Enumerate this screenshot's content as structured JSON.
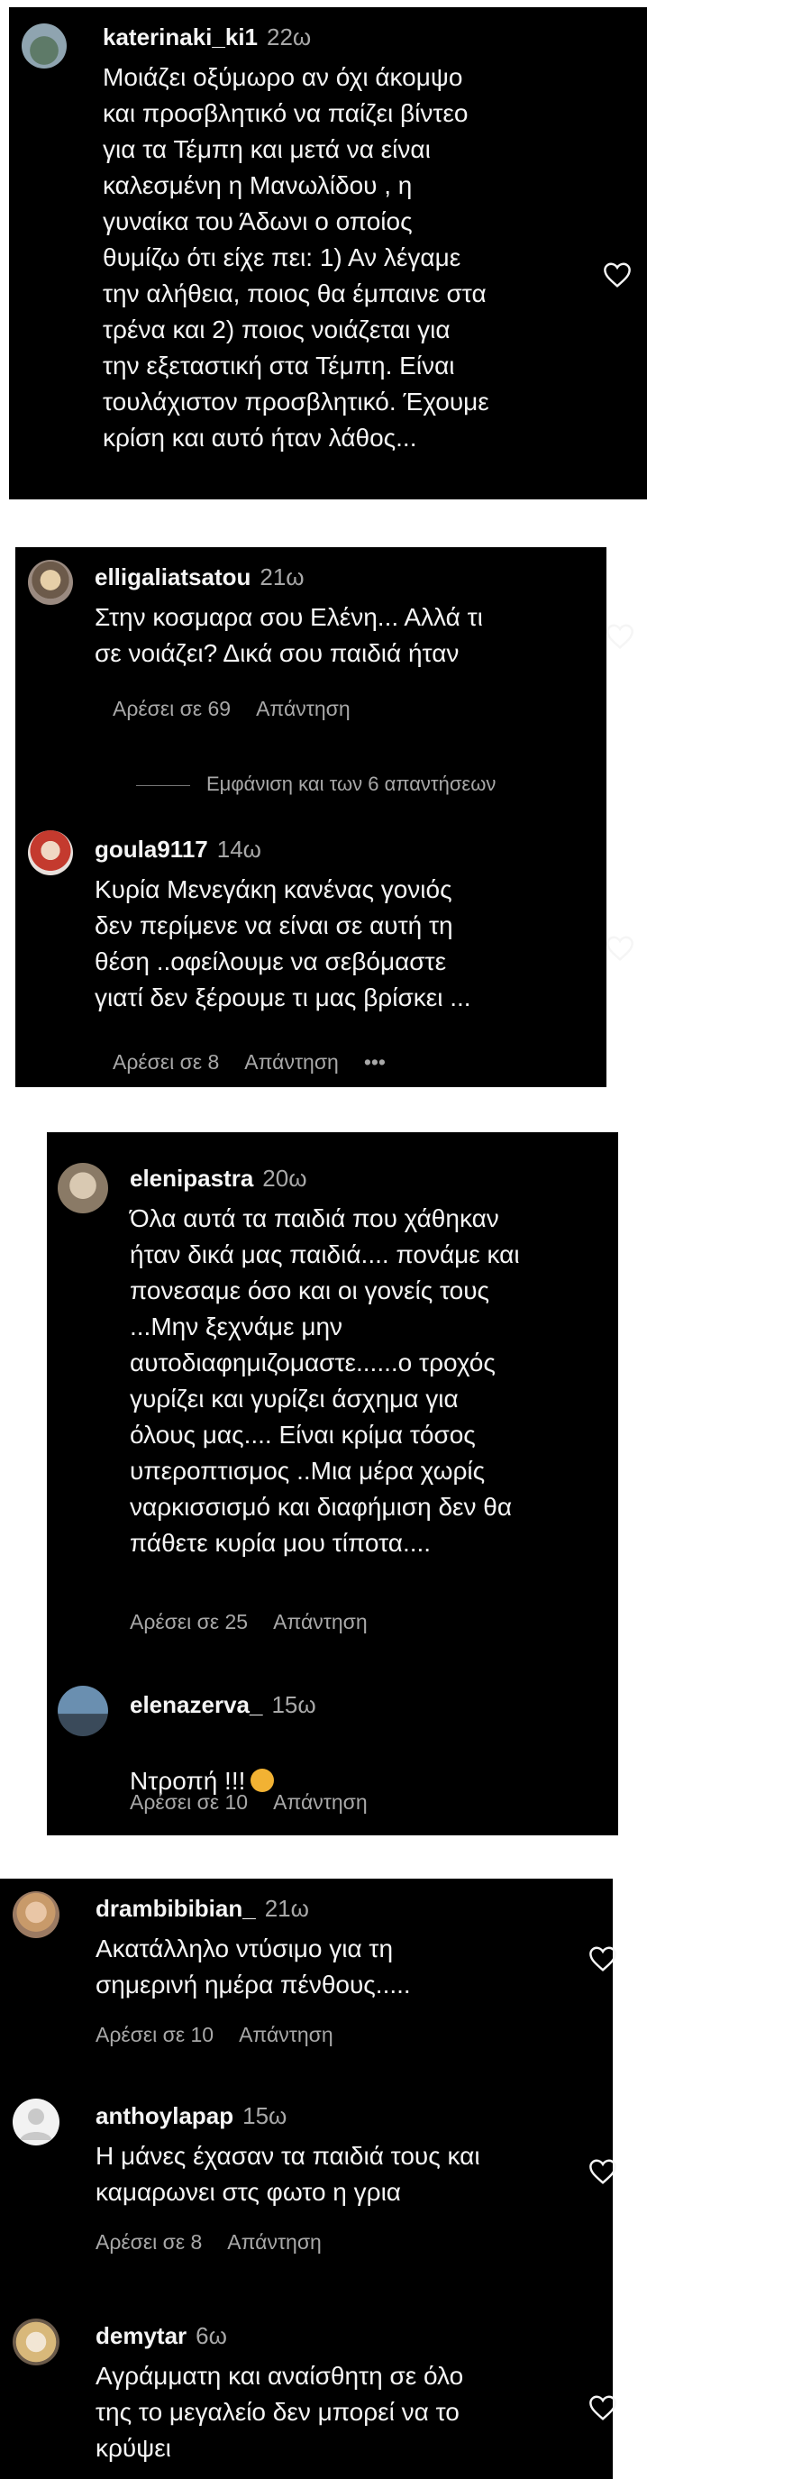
{
  "panels": [
    {
      "comments": [
        {
          "username": "katerinaki_ki1",
          "time": "22ω",
          "text": "Μοιάζει οξύμωρο αν όχι άκομψο\nκαι προσβλητικό να παίζει βίντεο\nγια τα Τέμπη και μετά να είναι\nκαλεσμένη η Μανωλίδου , η\nγυναίκα του Άδωνι ο οποίος\nθυμίζω ότι είχε πει: 1) Αν λέγαμε\nτην αλήθεια, ποιος θα έμπαινε στα\nτρένα και 2) ποιος νοιάζεται για\nτην εξεταστική στα Τέμπη. Είναι\nτουλάχιστον προσβλητικό. Έχουμε\nκρίση και αυτό ήταν λάθος..."
        }
      ]
    },
    {
      "comments": [
        {
          "username": "elligaliatsatou",
          "time": "21ω",
          "text": "Στην κοσμαρα σου Ελένη... Αλλά τι\nσε νοιάζει? Δικά σου παιδιά ήταν",
          "likes": "Αρέσει σε 69",
          "reply": "Απάντηση"
        },
        {
          "username": "goula9117",
          "time": "14ω",
          "text": "Κυρία Μενεγάκη κανένας γονιός\nδεν περίμενε να είναι σε αυτή τη\nθέση ..οφείλουμε να σεβόμαστε\nγιατί δεν ξέρουμε τι μας βρίσκει ...",
          "likes": "Αρέσει σε 8",
          "reply": "Απάντηση",
          "more": "•••"
        }
      ],
      "view_replies": "Εμφάνιση και των 6 απαντήσεων"
    },
    {
      "comments": [
        {
          "username": "elenipastra",
          "time": "20ω",
          "text": "Όλα αυτά τα παιδιά που χάθηκαν\nήταν δικά μας παιδιά.... πονάμε και\nπονεσαμε όσο και οι γονείς τους\n...Μην ξεχνάμε μην\nαυτοδιαφημιζομαστε......ο τροχός\nγυρίζει και γυρίζει άσχημα για\nόλους μας.... Είναι κρίμα τόσος\nυπεροπτισμος ..Μια μέρα χωρίς\nναρκισσισμό και διαφήμιση δεν θα\nπάθετε κυρία μου τίποτα....",
          "likes": "Αρέσει σε 25",
          "reply": "Απάντηση"
        },
        {
          "username": "elenazerva_",
          "time": "15ω",
          "text": "Ντροπή !!!",
          "likes": "Αρέσει σε 10",
          "reply": "Απάντηση"
        }
      ]
    },
    {
      "comments": [
        {
          "username": "drambibibian_",
          "time": "21ω",
          "text": "Ακατάλληλο ντύσιμο για τη\nσημερινή ημέρα πένθους.....",
          "likes": "Αρέσει σε 10",
          "reply": "Απάντηση"
        },
        {
          "username": "anthoylapap",
          "time": "15ω",
          "text": "Η μάνες έχασαν τα παιδιά τους και\nκαμαρωνει στς φωτο η γρια",
          "likes": "Αρέσει σε 8",
          "reply": "Απάντηση"
        },
        {
          "username": "demytar",
          "time": "6ω",
          "text": "Αγράμματη και αναίσθητη σε όλο\nτης το μεγαλείο δεν μπορεί να το\nκρύψει"
        }
      ]
    }
  ],
  "colors": {
    "panel_bg": "#000000",
    "text": "#f5f5f5",
    "muted": "#a8a8a8",
    "page_bg": "#ffffff"
  },
  "icons": {
    "like": "heart-outline-icon",
    "emoji": "sad-face-emoji-icon"
  }
}
